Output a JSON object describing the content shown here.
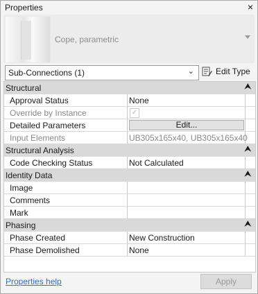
{
  "title": "Properties",
  "close_glyph": "×",
  "type_selector": {
    "type_name": "Cope, parametric",
    "thumbnail_icon": "beam-cope-icon"
  },
  "filter": {
    "selected": "Sub-Connections (1)",
    "edit_type_label": "Edit Type",
    "edit_type_icon": "edit-type-icon"
  },
  "groups": [
    {
      "name": "Structural",
      "rows": [
        {
          "name": "Approval Status",
          "value": "None",
          "kind": "text"
        },
        {
          "name": "Override by Instance",
          "value": "",
          "kind": "checkbox",
          "checked": true,
          "disabled": true
        },
        {
          "name": "Detailed Parameters",
          "value": "Edit...",
          "kind": "button"
        },
        {
          "name": "Input Elements",
          "value": "UB305x165x40, UB305x165x40",
          "kind": "text",
          "disabled": true
        }
      ]
    },
    {
      "name": "Structural Analysis",
      "rows": [
        {
          "name": "Code Checking Status",
          "value": "Not Calculated",
          "kind": "text"
        }
      ]
    },
    {
      "name": "Identity Data",
      "rows": [
        {
          "name": "Image",
          "value": "",
          "kind": "text"
        },
        {
          "name": "Comments",
          "value": "",
          "kind": "text"
        },
        {
          "name": "Mark",
          "value": "",
          "kind": "text"
        }
      ]
    },
    {
      "name": "Phasing",
      "rows": [
        {
          "name": "Phase Created",
          "value": "New Construction",
          "kind": "text"
        },
        {
          "name": "Phase Demolished",
          "value": "None",
          "kind": "text"
        }
      ]
    }
  ],
  "collapse_glyph": "⮝",
  "footer": {
    "help_link": "Properties help",
    "apply_label": "Apply",
    "apply_enabled": false
  }
}
